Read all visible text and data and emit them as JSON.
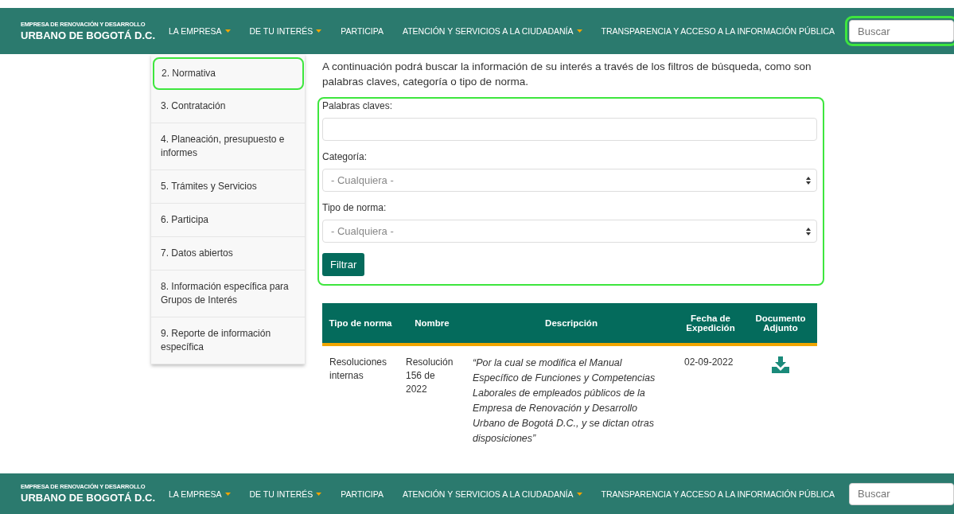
{
  "top_nav": {
    "logo_line1": "EMPRESA DE RENOVACIÓN Y DESARROLLO",
    "logo_line2": "URBANO DE BOGOTÁ D.C.",
    "items": [
      {
        "label": "LA EMPRESA",
        "dropdown": true
      },
      {
        "label": "DE TU INTERÉS",
        "dropdown": true
      },
      {
        "label": "PARTICIPA",
        "dropdown": false
      },
      {
        "label": "ATENCIÓN Y SERVICIOS A LA CIUDADANÍA",
        "dropdown": true
      },
      {
        "label": "TRANSPARENCIA Y ACCESO A LA INFORMACIÓN PÚBLICA",
        "dropdown": false
      }
    ],
    "search": {
      "placeholder": "Buscar",
      "focused": true
    }
  },
  "sidebar": {
    "items": [
      {
        "label": "2. Normativa",
        "selected": true
      },
      {
        "label": "3. Contratación",
        "selected": false
      },
      {
        "label": "4. Planeación, presupuesto e informes",
        "selected": false
      },
      {
        "label": "5. Trámites y Servicios",
        "selected": false
      },
      {
        "label": "6. Participa",
        "selected": false
      },
      {
        "label": "7. Datos abiertos",
        "selected": false
      },
      {
        "label": "8. Información específica para Grupos de Interés",
        "selected": false
      },
      {
        "label": "9. Reporte de información específica",
        "selected": false
      }
    ]
  },
  "intro": "A continuación podrá buscar la información de su interés a través de los filtros de búsqueda, como son palabras claves, categoría o tipo de norma.",
  "filter_form": {
    "fields": [
      {
        "kind": "text",
        "label": "Palabras claves:"
      },
      {
        "kind": "select",
        "label": "Categoría:",
        "value": "- Cualquiera -"
      },
      {
        "kind": "select",
        "label": "Tipo de norma:",
        "value": "- Cualquiera -"
      }
    ],
    "button": "Filtrar"
  },
  "table": {
    "columns": [
      "Tipo de norma",
      "Nombre",
      "Descripción",
      "Fecha de Expedición",
      "Documento Adjunto"
    ],
    "rows": [
      {
        "type": "Resoluciones internas",
        "name": "Resolución 156 de 2022",
        "description": "“Por la cual se modifica el Manual Específico de Funciones y Competencias Laborales de empleados públicos de la Empresa de Renovación y Desarrollo Urbano de Bogotá D.C., y se dictan otras disposiciones”",
        "date": "02-09-2022"
      }
    ]
  },
  "bottom_nav": {
    "logo_line1": "EMPRESA DE RENOVACIÓN Y DESARROLLO",
    "logo_line2": "URBANO DE BOGOTÁ D.C.",
    "items": [
      {
        "label": "LA EMPRESA",
        "dropdown": true
      },
      {
        "label": "DE TU INTERÉS",
        "dropdown": true
      },
      {
        "label": "PARTICIPA",
        "dropdown": false
      },
      {
        "label": "ATENCIÓN Y SERVICIOS A LA CIUDADANÍA",
        "dropdown": true
      },
      {
        "label": "TRANSPARENCIA Y ACCESO A LA INFORMACIÓN PÚBLICA",
        "dropdown": false
      }
    ],
    "search": {
      "placeholder": "Buscar",
      "focused": false
    }
  }
}
